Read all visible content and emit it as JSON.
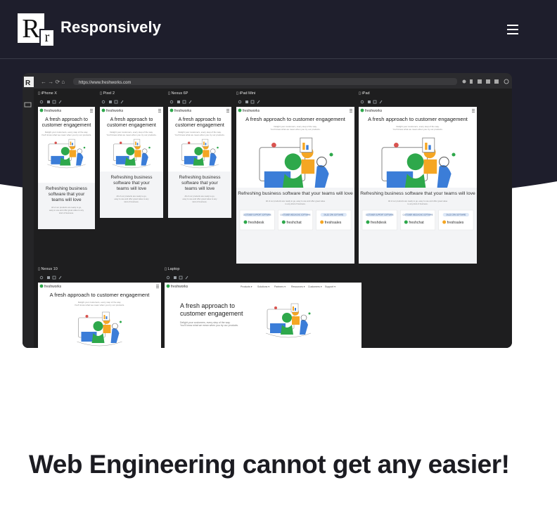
{
  "header": {
    "logo_big": "R",
    "logo_small": "r",
    "brand": "Responsively",
    "menu_icon": "hamburger-menu-icon"
  },
  "preview": {
    "url": "https://www.freshworks.com",
    "devices": [
      "iPhone X",
      "Pixel 2",
      "Nexus 6P",
      "iPad Mini",
      "iPad",
      "Nexus 10",
      "Laptop"
    ],
    "site": {
      "brand": "freshworks",
      "hero": "A fresh approach to customer engagement",
      "hero_sub_1": "Delight your customers, every step of the way.",
      "hero_sub_2": "You'll know what we mean when you try our products.",
      "section": "Refreshing business software that your teams will love",
      "section_sub": "All of our products are ready to go, easy to use and offer great value to any kind of business.",
      "products": [
        "freshdesk",
        "freshchat",
        "freshsales"
      ],
      "product_tags": [
        "CUSTOMER SUPPORT SOFTWARE",
        "CUSTOMER MESSAGING SOFTWARE",
        "SALES CRM SOFTWARE"
      ],
      "nav": [
        "Products",
        "Solutions",
        "Partners",
        "Resources",
        "Customers",
        "Support"
      ]
    }
  },
  "main": {
    "headline": "Web Engineering cannot get any easier!"
  },
  "colors": {
    "dark": "#1e1e2c",
    "accent_orange": "#f5a623",
    "accent_blue": "#3b7dd8",
    "accent_green": "#2ea84b"
  }
}
